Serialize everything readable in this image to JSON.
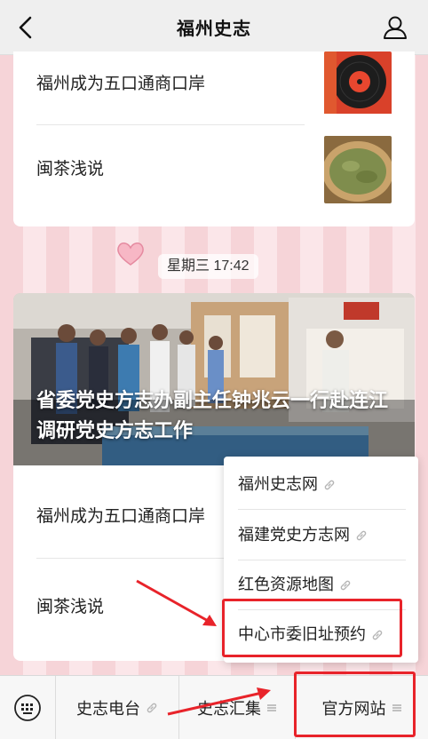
{
  "header": {
    "title": "福州史志"
  },
  "card1": {
    "items": [
      {
        "label": "福州成为五口通商口岸"
      },
      {
        "label": "闽茶浅说"
      }
    ]
  },
  "timestamp": "星期三 17:42",
  "card2": {
    "headline": "省委党史方志办副主任钟兆云一行赴连江调研党史方志工作",
    "items": [
      {
        "label": "福州成为五口通商口岸"
      },
      {
        "label": "闽茶浅说"
      }
    ]
  },
  "popup_menu": {
    "items": [
      {
        "label": "福州史志网"
      },
      {
        "label": "福建党史方志网"
      },
      {
        "label": "红色资源地图"
      },
      {
        "label": "中心市委旧址预约"
      }
    ]
  },
  "bottom_bar": {
    "items": [
      {
        "label": "史志电台"
      },
      {
        "label": "史志汇集"
      },
      {
        "label": "官方网站"
      }
    ]
  },
  "colors": {
    "annotation": "#e8232a",
    "background_pink": "#f6d4d8"
  },
  "icons": [
    "back-arrow-icon",
    "profile-icon",
    "link-icon",
    "menu-lines-icon",
    "keyboard-icon"
  ]
}
